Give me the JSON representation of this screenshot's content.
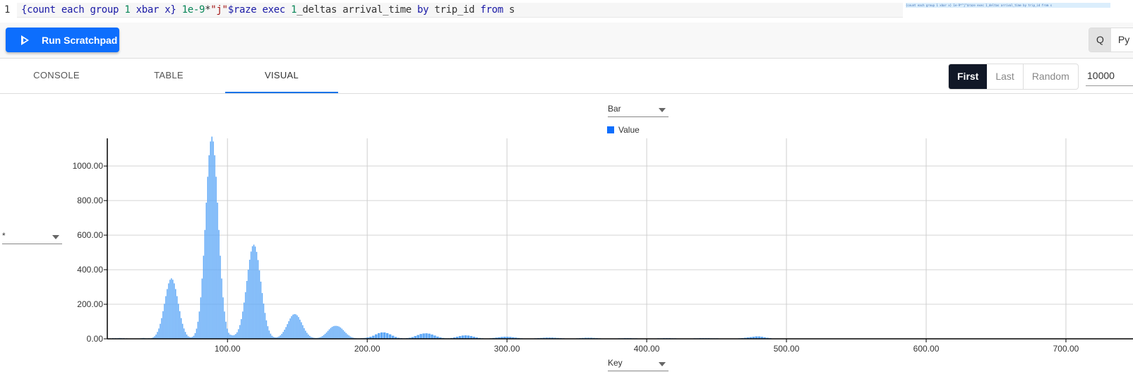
{
  "editor": {
    "line_number": "1",
    "code_tokens": [
      {
        "t": "{count each group ",
        "k": "kw"
      },
      {
        "t": "1",
        "k": "num"
      },
      {
        "t": " xbar x} ",
        "k": "kw"
      },
      {
        "t": "1e-9",
        "k": "num"
      },
      {
        "t": "*",
        "k": "id"
      },
      {
        "t": "\"j\"",
        "k": "str"
      },
      {
        "t": "$raze exec ",
        "k": "kw"
      },
      {
        "t": "1",
        "k": "num"
      },
      {
        "t": "_deltas arrival_time ",
        "k": "id"
      },
      {
        "t": "by",
        "k": "kw"
      },
      {
        "t": " trip_id ",
        "k": "id"
      },
      {
        "t": "from",
        "k": "kw"
      },
      {
        "t": " s",
        "k": "id"
      }
    ],
    "minimap_text": "{count each group 1 xbar x} 1e-9*\"j\"$raze exec 1_deltas arrival_time by trip_id from s"
  },
  "toolbar": {
    "run_label": "Run Scratchpad",
    "run_icon": "play-icon",
    "languages": [
      "Q",
      "Py"
    ],
    "active_language": "Q"
  },
  "tabs": [
    {
      "label": "CONSOLE"
    },
    {
      "label": "TABLE"
    },
    {
      "label": "VISUAL",
      "active": true
    }
  ],
  "row_selector": {
    "options": [
      "First",
      "Last",
      "Random"
    ],
    "active": "First",
    "count_value": "10000"
  },
  "chart_controls": {
    "chart_type": "Bar",
    "y_column": "*",
    "x_column": "Key",
    "legend_label": "Value"
  },
  "colors": {
    "accent": "#0d6efd",
    "bar": "#5ea8f7",
    "legend_swatch": "#0d6efd"
  },
  "chart_data": {
    "type": "bar",
    "xlabel": "Key",
    "legend": [
      "Value"
    ],
    "legend_placement": "top-center",
    "grid": true,
    "xlim": [
      14,
      748
    ],
    "ylim": [
      0,
      1160
    ],
    "x_ticks": [
      "100.00",
      "200.00",
      "300.00",
      "400.00",
      "500.00",
      "600.00",
      "700.00"
    ],
    "y_ticks": [
      "0.00",
      "200.00",
      "400.00",
      "600.00",
      "800.00",
      "1000.00"
    ],
    "points": [
      [
        15,
        2
      ],
      [
        16,
        3
      ],
      [
        17,
        2
      ],
      [
        18,
        4
      ],
      [
        19,
        3
      ],
      [
        20,
        4
      ],
      [
        21,
        3
      ],
      [
        22,
        4
      ],
      [
        23,
        5
      ],
      [
        24,
        4
      ],
      [
        25,
        3
      ],
      [
        26,
        4
      ],
      [
        27,
        2
      ],
      [
        28,
        3
      ],
      [
        29,
        2
      ],
      [
        30,
        2
      ],
      [
        31,
        1
      ],
      [
        32,
        1
      ],
      [
        33,
        1
      ],
      [
        35,
        1
      ],
      [
        36,
        1
      ],
      [
        37,
        2
      ],
      [
        38,
        3
      ],
      [
        39,
        4
      ],
      [
        40,
        5
      ],
      [
        41,
        4
      ],
      [
        42,
        3
      ],
      [
        43,
        3
      ],
      [
        44,
        4
      ],
      [
        45,
        3
      ],
      [
        46,
        5
      ],
      [
        47,
        9
      ],
      [
        48,
        15
      ],
      [
        49,
        25
      ],
      [
        50,
        40
      ],
      [
        51,
        60
      ],
      [
        52,
        87
      ],
      [
        53,
        120
      ],
      [
        54,
        160
      ],
      [
        55,
        203
      ],
      [
        56,
        247
      ],
      [
        57,
        288
      ],
      [
        58,
        321
      ],
      [
        59,
        342
      ],
      [
        60,
        350
      ],
      [
        61,
        342
      ],
      [
        62,
        321
      ],
      [
        63,
        288
      ],
      [
        64,
        247
      ],
      [
        65,
        203
      ],
      [
        66,
        160
      ],
      [
        67,
        120
      ],
      [
        68,
        87
      ],
      [
        69,
        60
      ],
      [
        70,
        40
      ],
      [
        71,
        25
      ],
      [
        72,
        15
      ],
      [
        73,
        11
      ],
      [
        74,
        9
      ],
      [
        75,
        12
      ],
      [
        76,
        18
      ],
      [
        77,
        33
      ],
      [
        78,
        59
      ],
      [
        79,
        99
      ],
      [
        80,
        158
      ],
      [
        81,
        240
      ],
      [
        82,
        349
      ],
      [
        83,
        481
      ],
      [
        84,
        630
      ],
      [
        85,
        788
      ],
      [
        86,
        938
      ],
      [
        87,
        1062
      ],
      [
        88,
        1142
      ],
      [
        89,
        1170
      ],
      [
        90,
        1142
      ],
      [
        91,
        1062
      ],
      [
        92,
        938
      ],
      [
        93,
        788
      ],
      [
        94,
        630
      ],
      [
        95,
        481
      ],
      [
        96,
        349
      ],
      [
        97,
        240
      ],
      [
        98,
        158
      ],
      [
        99,
        99
      ],
      [
        100,
        59
      ],
      [
        101,
        35
      ],
      [
        102,
        25
      ],
      [
        103,
        22
      ],
      [
        104,
        20
      ],
      [
        105,
        22
      ],
      [
        106,
        28
      ],
      [
        107,
        38
      ],
      [
        108,
        56
      ],
      [
        109,
        80
      ],
      [
        110,
        114
      ],
      [
        111,
        158
      ],
      [
        112,
        210
      ],
      [
        113,
        270
      ],
      [
        114,
        335
      ],
      [
        115,
        400
      ],
      [
        116,
        458
      ],
      [
        117,
        505
      ],
      [
        118,
        536
      ],
      [
        119,
        545
      ],
      [
        120,
        534
      ],
      [
        121,
        503
      ],
      [
        122,
        456
      ],
      [
        123,
        396
      ],
      [
        124,
        331
      ],
      [
        125,
        265
      ],
      [
        126,
        204
      ],
      [
        127,
        150
      ],
      [
        128,
        107
      ],
      [
        129,
        73
      ],
      [
        130,
        48
      ],
      [
        131,
        30
      ],
      [
        132,
        18
      ],
      [
        133,
        12
      ],
      [
        134,
        9
      ],
      [
        135,
        8
      ],
      [
        136,
        10
      ],
      [
        137,
        14
      ],
      [
        138,
        20
      ],
      [
        139,
        29
      ],
      [
        140,
        40
      ],
      [
        141,
        53
      ],
      [
        142,
        68
      ],
      [
        143,
        85
      ],
      [
        144,
        102
      ],
      [
        145,
        118
      ],
      [
        146,
        131
      ],
      [
        147,
        140
      ],
      [
        148,
        143
      ],
      [
        149,
        142
      ],
      [
        150,
        136
      ],
      [
        151,
        126
      ],
      [
        152,
        111
      ],
      [
        153,
        96
      ],
      [
        154,
        79
      ],
      [
        155,
        62
      ],
      [
        156,
        47
      ],
      [
        157,
        35
      ],
      [
        158,
        25
      ],
      [
        159,
        17
      ],
      [
        160,
        11
      ],
      [
        161,
        8
      ],
      [
        162,
        6
      ],
      [
        163,
        5
      ],
      [
        164,
        5
      ],
      [
        165,
        6
      ],
      [
        166,
        8
      ],
      [
        167,
        11
      ],
      [
        168,
        16
      ],
      [
        169,
        22
      ],
      [
        170,
        29
      ],
      [
        171,
        37
      ],
      [
        172,
        46
      ],
      [
        173,
        55
      ],
      [
        174,
        63
      ],
      [
        175,
        69
      ],
      [
        176,
        73
      ],
      [
        177,
        75
      ],
      [
        178,
        75
      ],
      [
        179,
        74
      ],
      [
        180,
        71
      ],
      [
        181,
        66
      ],
      [
        182,
        59
      ],
      [
        183,
        51
      ],
      [
        184,
        42
      ],
      [
        185,
        34
      ],
      [
        186,
        26
      ],
      [
        187,
        20
      ],
      [
        188,
        14
      ],
      [
        189,
        10
      ],
      [
        190,
        7
      ],
      [
        191,
        5
      ],
      [
        192,
        4
      ],
      [
        193,
        3
      ],
      [
        194,
        3
      ],
      [
        195,
        3
      ],
      [
        196,
        4
      ],
      [
        197,
        4
      ],
      [
        198,
        5
      ],
      [
        199,
        6
      ],
      [
        200,
        8
      ],
      [
        202,
        12
      ],
      [
        204,
        18
      ],
      [
        206,
        26
      ],
      [
        208,
        33
      ],
      [
        210,
        37
      ],
      [
        212,
        37
      ],
      [
        214,
        33
      ],
      [
        216,
        26
      ],
      [
        218,
        18
      ],
      [
        220,
        11
      ],
      [
        222,
        6
      ],
      [
        224,
        4
      ],
      [
        226,
        3
      ],
      [
        228,
        4
      ],
      [
        230,
        6
      ],
      [
        232,
        10
      ],
      [
        234,
        16
      ],
      [
        236,
        22
      ],
      [
        238,
        28
      ],
      [
        240,
        31
      ],
      [
        242,
        32
      ],
      [
        244,
        30
      ],
      [
        246,
        25
      ],
      [
        248,
        19
      ],
      [
        250,
        13
      ],
      [
        252,
        8
      ],
      [
        254,
        5
      ],
      [
        256,
        3
      ],
      [
        258,
        3
      ],
      [
        260,
        5
      ],
      [
        262,
        8
      ],
      [
        264,
        12
      ],
      [
        266,
        16
      ],
      [
        268,
        19
      ],
      [
        270,
        20
      ],
      [
        272,
        19
      ],
      [
        274,
        16
      ],
      [
        276,
        12
      ],
      [
        278,
        8
      ],
      [
        280,
        5
      ],
      [
        282,
        3
      ],
      [
        284,
        2
      ],
      [
        286,
        2
      ],
      [
        288,
        3
      ],
      [
        290,
        5
      ],
      [
        292,
        7
      ],
      [
        294,
        9
      ],
      [
        296,
        11
      ],
      [
        298,
        12
      ],
      [
        300,
        12
      ],
      [
        302,
        11
      ],
      [
        304,
        9
      ],
      [
        306,
        7
      ],
      [
        308,
        5
      ],
      [
        310,
        3
      ],
      [
        312,
        2
      ],
      [
        314,
        2
      ],
      [
        316,
        2
      ],
      [
        318,
        2
      ],
      [
        320,
        3
      ],
      [
        322,
        4
      ],
      [
        324,
        5
      ],
      [
        326,
        6
      ],
      [
        328,
        7
      ],
      [
        330,
        7
      ],
      [
        332,
        7
      ],
      [
        334,
        6
      ],
      [
        336,
        5
      ],
      [
        338,
        4
      ],
      [
        340,
        3
      ],
      [
        342,
        2
      ],
      [
        344,
        2
      ],
      [
        346,
        2
      ],
      [
        348,
        2
      ],
      [
        350,
        3
      ],
      [
        352,
        4
      ],
      [
        354,
        5
      ],
      [
        356,
        6
      ],
      [
        358,
        6
      ],
      [
        360,
        6
      ],
      [
        362,
        5
      ],
      [
        364,
        4
      ],
      [
        366,
        3
      ],
      [
        368,
        2
      ],
      [
        370,
        2
      ],
      [
        372,
        1
      ],
      [
        374,
        2
      ],
      [
        376,
        2
      ],
      [
        378,
        2
      ],
      [
        380,
        3
      ],
      [
        382,
        3
      ],
      [
        384,
        4
      ],
      [
        386,
        4
      ],
      [
        388,
        4
      ],
      [
        390,
        3
      ],
      [
        392,
        3
      ],
      [
        394,
        2
      ],
      [
        396,
        2
      ],
      [
        398,
        1
      ],
      [
        400,
        1
      ],
      [
        402,
        1
      ],
      [
        404,
        2
      ],
      [
        406,
        2
      ],
      [
        408,
        3
      ],
      [
        410,
        3
      ],
      [
        412,
        4
      ],
      [
        414,
        4
      ],
      [
        416,
        4
      ],
      [
        418,
        3
      ],
      [
        420,
        3
      ],
      [
        422,
        2
      ],
      [
        424,
        1
      ],
      [
        426,
        1
      ],
      [
        428,
        1
      ],
      [
        430,
        2
      ],
      [
        432,
        2
      ],
      [
        434,
        3
      ],
      [
        436,
        3
      ],
      [
        438,
        4
      ],
      [
        440,
        4
      ],
      [
        442,
        4
      ],
      [
        444,
        4
      ],
      [
        446,
        3
      ],
      [
        448,
        3
      ],
      [
        450,
        3
      ],
      [
        452,
        2
      ],
      [
        454,
        2
      ],
      [
        456,
        2
      ],
      [
        458,
        2
      ],
      [
        460,
        2
      ],
      [
        462,
        1
      ],
      [
        464,
        2
      ],
      [
        466,
        3
      ],
      [
        468,
        4
      ],
      [
        470,
        6
      ],
      [
        472,
        8
      ],
      [
        474,
        10
      ],
      [
        476,
        12
      ],
      [
        478,
        14
      ],
      [
        480,
        14
      ],
      [
        482,
        12
      ],
      [
        484,
        9
      ],
      [
        486,
        6
      ],
      [
        488,
        4
      ],
      [
        490,
        2
      ],
      [
        492,
        2
      ],
      [
        494,
        1
      ],
      [
        496,
        1
      ],
      [
        498,
        1
      ],
      [
        500,
        1
      ],
      [
        504,
        1
      ],
      [
        508,
        1
      ],
      [
        512,
        2
      ],
      [
        516,
        1
      ],
      [
        520,
        1
      ],
      [
        530,
        1
      ],
      [
        534,
        2
      ],
      [
        538,
        2
      ],
      [
        542,
        2
      ],
      [
        546,
        2
      ],
      [
        550,
        2
      ],
      [
        554,
        1
      ],
      [
        560,
        1
      ],
      [
        564,
        2
      ],
      [
        568,
        2
      ],
      [
        572,
        2
      ],
      [
        576,
        1
      ],
      [
        590,
        1
      ],
      [
        596,
        2
      ],
      [
        600,
        2
      ],
      [
        604,
        2
      ],
      [
        610,
        1
      ],
      [
        630,
        1
      ],
      [
        634,
        1
      ],
      [
        690,
        1
      ],
      [
        694,
        2
      ],
      [
        698,
        2
      ],
      [
        702,
        2
      ],
      [
        706,
        1
      ],
      [
        718,
        1
      ],
      [
        722,
        1
      ]
    ]
  }
}
